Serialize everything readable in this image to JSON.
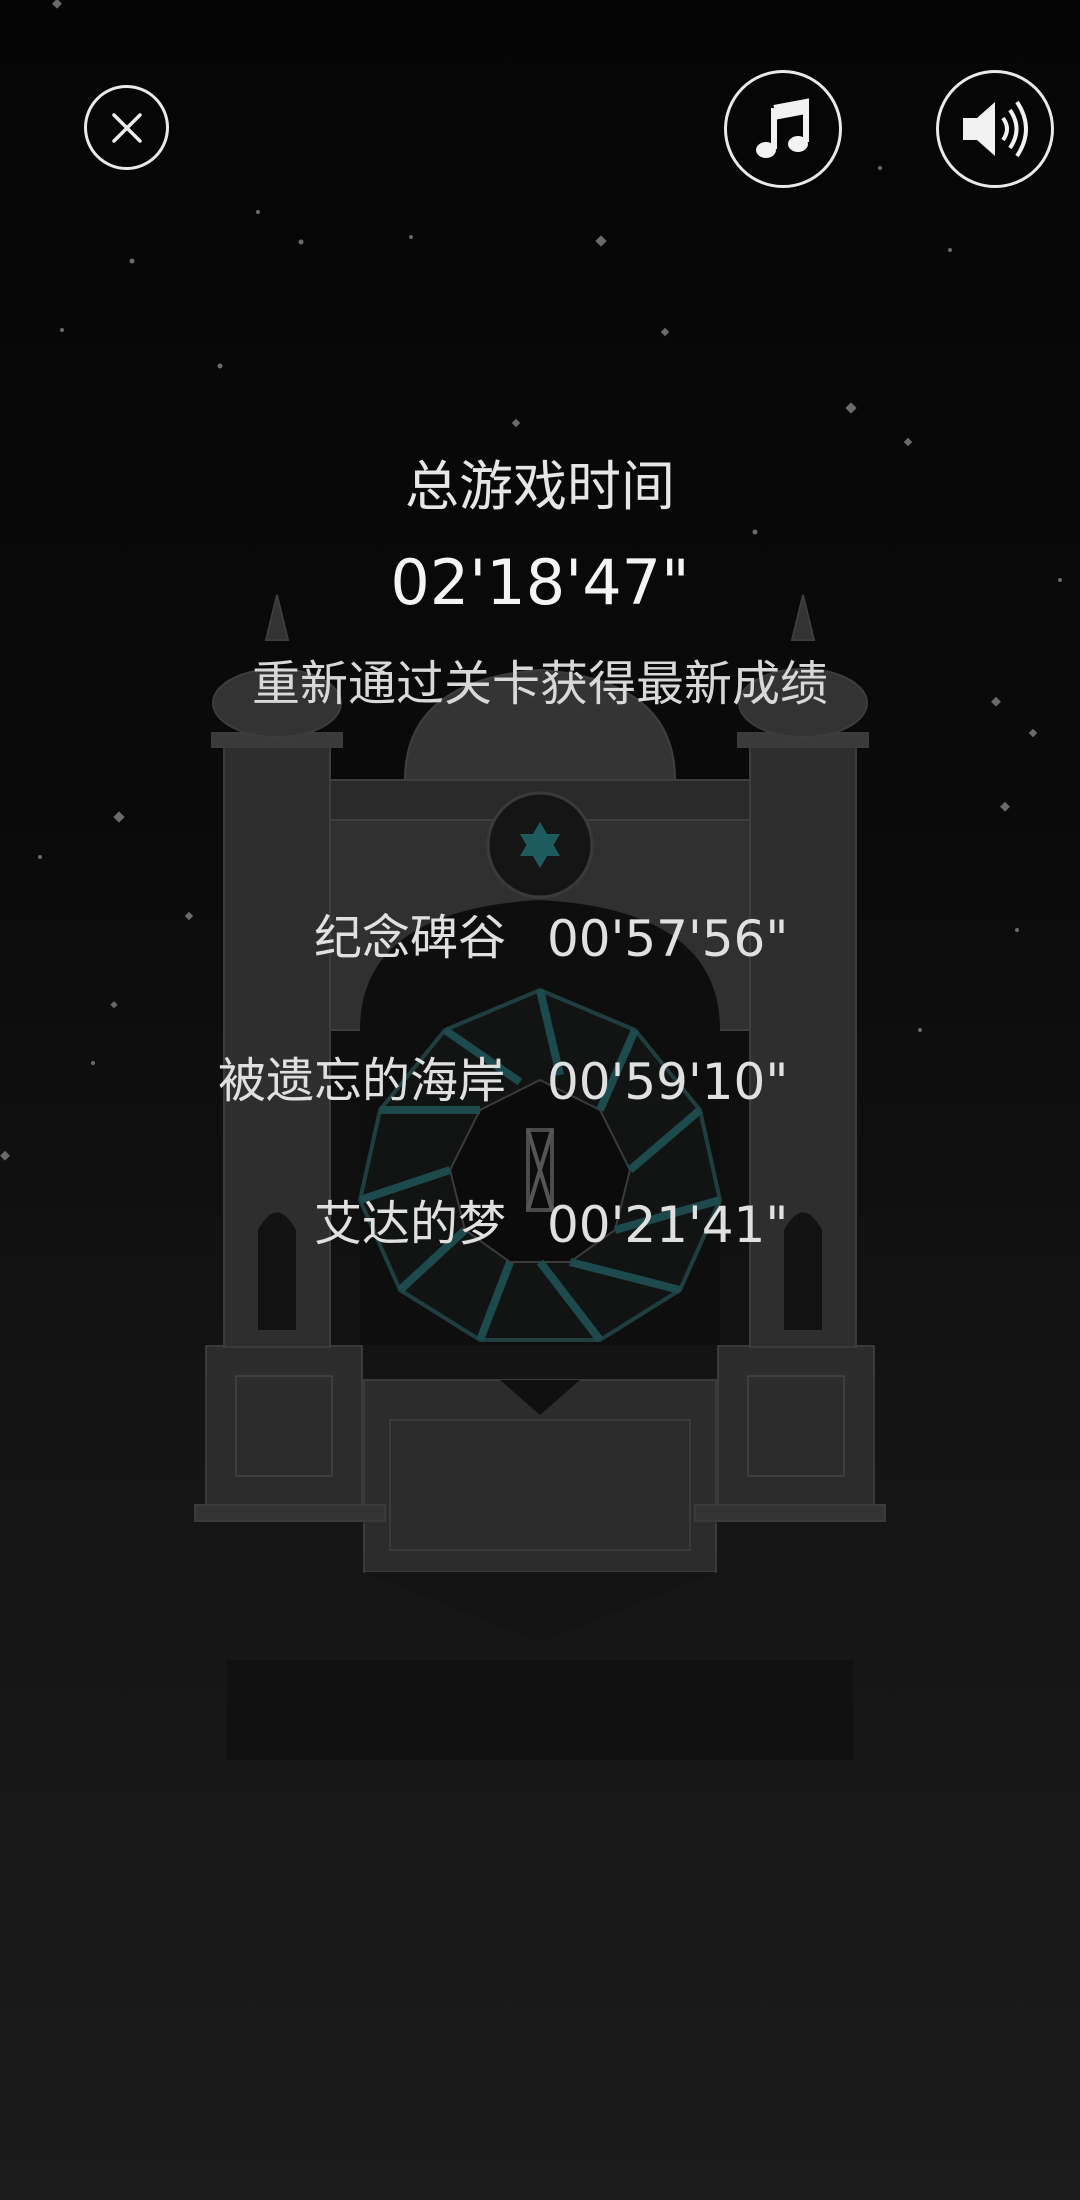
{
  "hud": {
    "close_icon": "close-icon",
    "music_icon": "music-note-icon",
    "sound_icon": "speaker-volume-icon"
  },
  "summary": {
    "total_label": "总游戏时间",
    "total_time": "02'18'47\"",
    "replay_hint": "重新通过关卡获得最新成绩"
  },
  "levels": [
    {
      "name": "纪念碑谷",
      "time": "00'57'56\""
    },
    {
      "name": "被遗忘的海岸",
      "time": "00'59'10\""
    },
    {
      "name": "艾达的梦",
      "time": "00'21'41\""
    }
  ],
  "colors": {
    "background": "#0b0b0b",
    "monument": "#3a3a3a",
    "teal_accent": "#1e5b5f",
    "text": "#e2e2e2"
  }
}
